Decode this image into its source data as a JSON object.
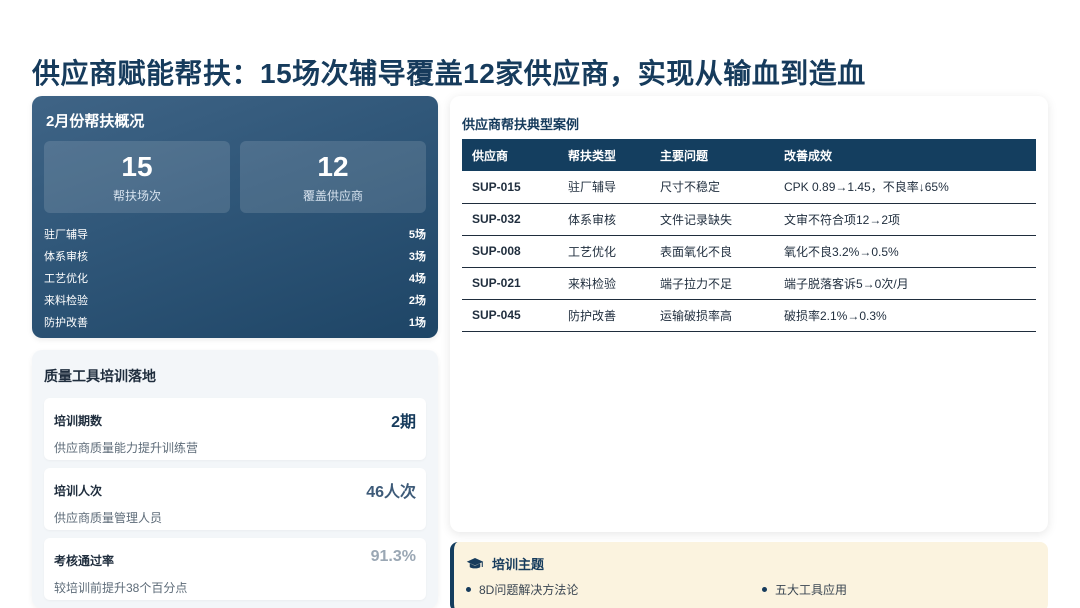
{
  "page": {
    "title": "供应商赋能帮扶：15场次辅导覆盖12家供应商，实现从输血到造血"
  },
  "overview": {
    "title": "2月份帮扶概况",
    "stats": [
      {
        "value": "15",
        "label": "帮扶场次"
      },
      {
        "value": "12",
        "label": "覆盖供应商"
      }
    ],
    "breakdown": [
      {
        "name": "驻厂辅导",
        "count": "5场"
      },
      {
        "name": "体系审核",
        "count": "3场"
      },
      {
        "name": "工艺优化",
        "count": "4场"
      },
      {
        "name": "来料检验",
        "count": "2场"
      },
      {
        "name": "防护改善",
        "count": "1场"
      }
    ]
  },
  "training": {
    "title": "质量工具培训落地",
    "metrics": [
      {
        "label": "培训期数",
        "value": "2期",
        "sub": "供应商质量能力提升训练营",
        "color": "#163b5c"
      },
      {
        "label": "培训人次",
        "value": "46人次",
        "sub": "供应商质量管理人员",
        "color": "#3d5a78"
      },
      {
        "label": "考核通过率",
        "value": "91.3%",
        "sub": "较培训前提升38个百分点",
        "color": "#9aa7b4"
      }
    ]
  },
  "cases": {
    "title": "供应商帮扶典型案例",
    "headers": [
      "供应商",
      "帮扶类型",
      "主要问题",
      "改善成效"
    ],
    "rows": [
      [
        "SUP-015",
        "驻厂辅导",
        "尺寸不稳定",
        "CPK 0.89→1.45，不良率↓65%"
      ],
      [
        "SUP-032",
        "体系审核",
        "文件记录缺失",
        "文审不符合项12→2项"
      ],
      [
        "SUP-008",
        "工艺优化",
        "表面氧化不良",
        "氧化不良3.2%→0.5%"
      ],
      [
        "SUP-021",
        "来料检验",
        "端子拉力不足",
        "端子脱落客诉5→0次/月"
      ],
      [
        "SUP-045",
        "防护改善",
        "运输破损率高",
        "破损率2.1%→0.3%"
      ]
    ]
  },
  "topics": {
    "icon": "graduation-cap-icon",
    "title": "培训主题",
    "items": [
      "8D问题解决方法论",
      "五大工具应用"
    ]
  },
  "colors": {
    "brand": "#163b5c",
    "table_header": "#143e5f",
    "topics_bg": "#fbf3df"
  }
}
